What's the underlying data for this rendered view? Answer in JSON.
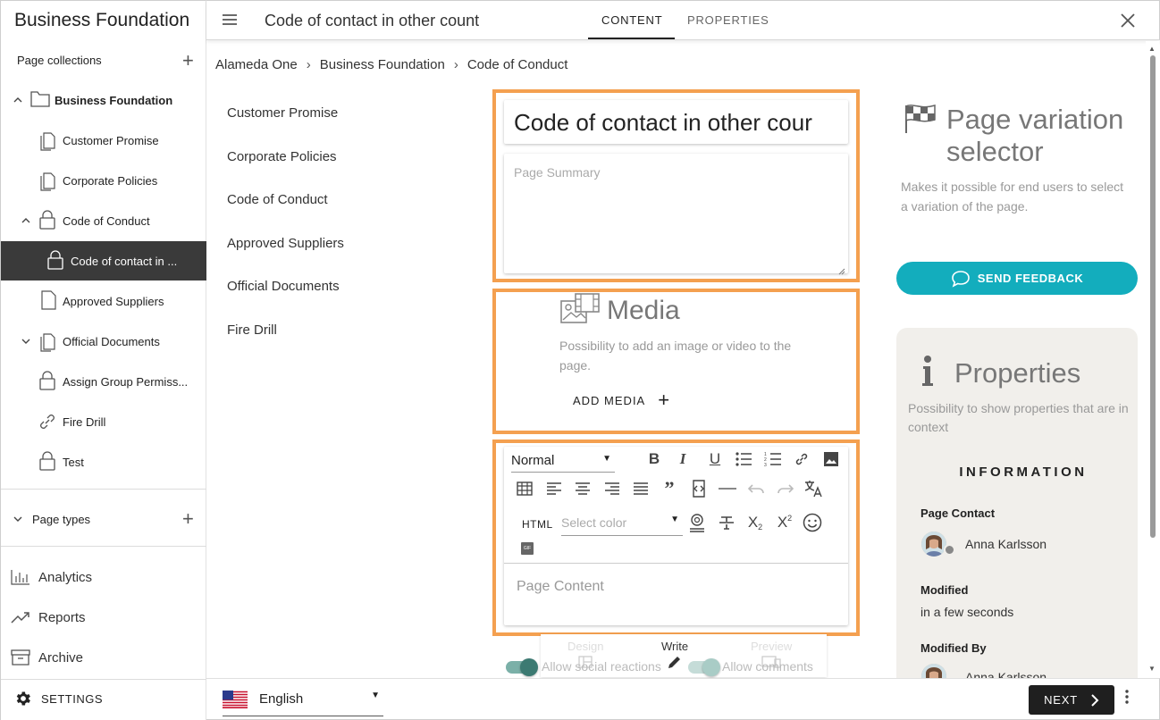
{
  "sidebar": {
    "app_title": "Business Foundation",
    "page_collections_label": "Page collections",
    "tree": [
      {
        "label": "Business Foundation",
        "icon": "folder-icon",
        "chevron": "up"
      },
      {
        "label": "Customer Promise",
        "icon": "pages-icon"
      },
      {
        "label": "Corporate Policies",
        "icon": "pages-icon"
      },
      {
        "label": "Code of Conduct",
        "icon": "lock-icon",
        "chevron": "up"
      },
      {
        "label": "Code of contact in ...",
        "icon": "lock-icon"
      },
      {
        "label": "Approved Suppliers",
        "icon": "page-icon"
      },
      {
        "label": "Official Documents",
        "icon": "pages-icon",
        "chevron": "down"
      },
      {
        "label": "Assign Group Permiss...",
        "icon": "lock-icon"
      },
      {
        "label": "Fire Drill",
        "icon": "link-icon"
      },
      {
        "label": "Test",
        "icon": "lock-icon"
      }
    ],
    "page_types_label": "Page types",
    "nav": [
      {
        "label": "Analytics",
        "icon": "analytics-icon"
      },
      {
        "label": "Reports",
        "icon": "trending-icon"
      },
      {
        "label": "Archive",
        "icon": "archive-icon"
      }
    ],
    "settings_label": "SETTINGS"
  },
  "topbar": {
    "title": "Code of contact in other count",
    "tabs": [
      "CONTENT",
      "PROPERTIES"
    ],
    "active_tab": "CONTENT"
  },
  "breadcrumb": [
    "Alameda One",
    "Business Foundation",
    "Code of Conduct"
  ],
  "subnav": [
    "Customer Promise",
    "Corporate Policies",
    "Code of Conduct",
    "Approved Suppliers",
    "Official Documents",
    "Fire Drill"
  ],
  "editor": {
    "title_value": "Code of contact in other cour",
    "summary_placeholder": "Page Summary",
    "media_title": "Media",
    "media_desc": "Possibility to add an image or video to the page.",
    "add_media_label": "ADD MEDIA",
    "format_value": "Normal",
    "html_label": "HTML",
    "color_placeholder": "Select color",
    "gif_label": "GIF",
    "content_placeholder": "Page Content",
    "bottom_tabs": [
      "Design",
      "Write",
      "Preview"
    ],
    "toggle_social": "Allow social reactions",
    "toggle_comments": "Allow comments"
  },
  "right": {
    "pvs_title": "Page variation selector",
    "pvs_desc": "Makes it possible for end users to select a variation of the page.",
    "feedback_label": "SEND FEEDBACK",
    "props_title": "Properties",
    "props_desc": "Possibility to show properties that are in context",
    "info_head": "INFORMATION",
    "contact_label": "Page Contact",
    "contact_name": "Anna Karlsson",
    "modified_label": "Modified",
    "modified_value": "in a few seconds",
    "modified_by_label": "Modified By",
    "modified_by_name": "Anna Karlsson"
  },
  "footer": {
    "language": "English",
    "next_label": "NEXT"
  },
  "colors": {
    "accent_teal": "#13adbd",
    "highlight_orange": "#f4a050",
    "active_item_bg": "#3a3a3a"
  }
}
